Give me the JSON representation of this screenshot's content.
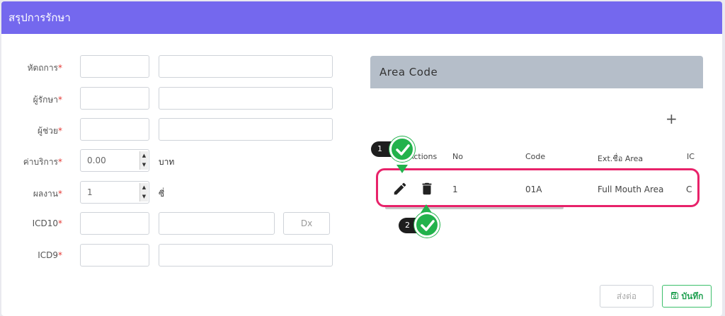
{
  "window": {
    "title": "สรุปการรักษา"
  },
  "form": {
    "rows": [
      {
        "label": "หัตถการ",
        "required": "*"
      },
      {
        "label": "ผู้รักษา",
        "required": "*"
      },
      {
        "label": "ผู้ช่วย",
        "required": "*"
      },
      {
        "label": "ค่าบริการ",
        "required": "*",
        "value": "0.00",
        "unit": "บาท"
      },
      {
        "label": "ผลงาน",
        "required": "*",
        "value": "1",
        "unit": "ซี่"
      },
      {
        "label": "ICD10",
        "required": "*",
        "button": "Dx"
      },
      {
        "label": "ICD9",
        "required": "*"
      }
    ]
  },
  "area_panel": {
    "title": "Area Code",
    "add_icon": "plus-icon",
    "columns": [
      "Actions",
      "No",
      "Code",
      "Ext.ชื่อ Area",
      "IC"
    ],
    "rows": [
      {
        "no": "1",
        "code": "01A",
        "ext_name": "Full Mouth Area",
        "ic": "C"
      }
    ],
    "row_icons": [
      "pencil-icon",
      "trash-icon"
    ]
  },
  "annotations": [
    {
      "number": "1",
      "icon": "check-icon"
    },
    {
      "number": "2",
      "icon": "check-icon"
    }
  ],
  "footer": {
    "next_label": "ส่งต่อ",
    "save_label": "บันทึก",
    "save_icon": "floppy-disk-icon"
  },
  "colors": {
    "header": "#7468ee",
    "highlight": "#e8226a",
    "check": "#22b24c",
    "save": "#22a152"
  }
}
